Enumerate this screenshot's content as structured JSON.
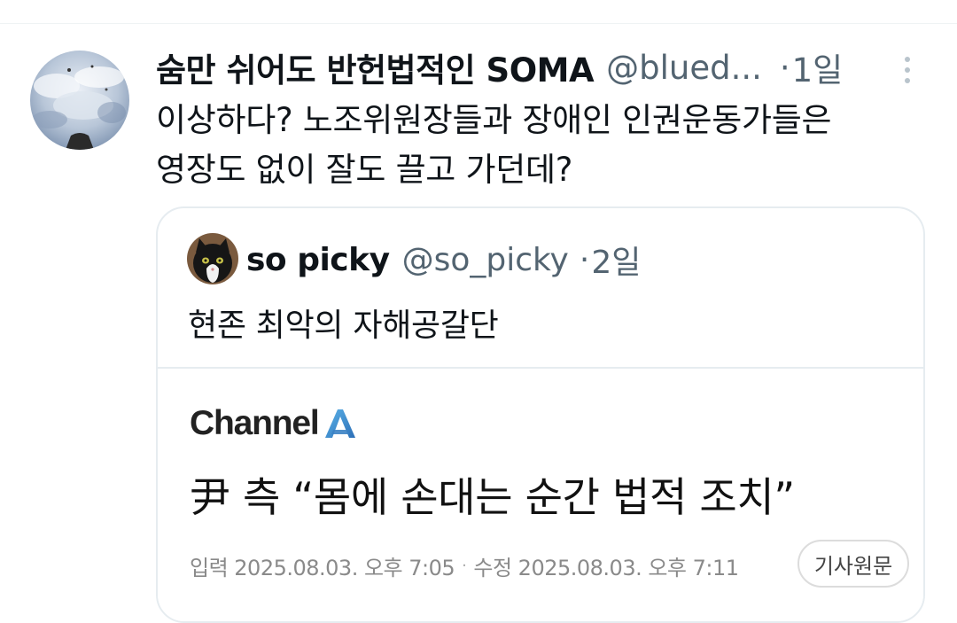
{
  "tweet": {
    "display_name": "숨만 쉬어도 반헌법적인 SOMA",
    "handle": "@blued...",
    "dot": "·",
    "time": "1일",
    "text_line1": "이상하다? 노조위원장들과 장애인 인권운동가들은",
    "text_line2": "영장도 없이 잘도 끌고 가던데?",
    "icons": {
      "more": "more-vertical-icon"
    }
  },
  "quote": {
    "display_name": "so picky",
    "handle": "@so_picky",
    "dot": "·",
    "time": "2일",
    "text": "현존 최악의 자해공갈단",
    "news": {
      "brand": "Channel",
      "brand_logo_icon": "channel-a-logo",
      "brand_accent": "#3b82c4",
      "headline": "尹 측 “몸에 손대는 순간 법적 조치”",
      "published": "입력 2025.08.03. 오후 7:05",
      "separator": "·",
      "modified": "수정 2025.08.03. 오후 7:11",
      "original_button": "기사원문"
    }
  }
}
